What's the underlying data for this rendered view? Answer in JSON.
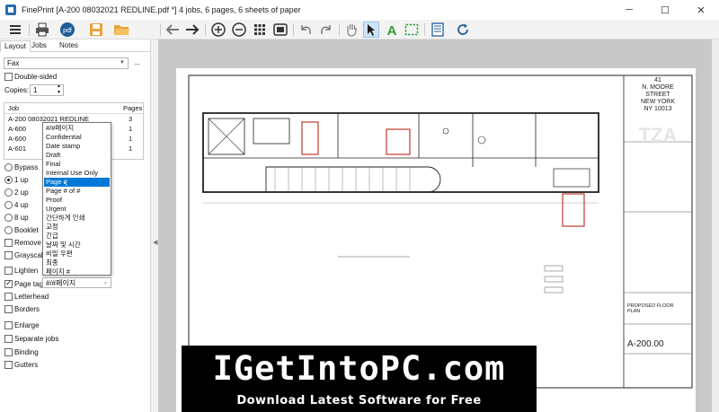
{
  "window": {
    "title": "FinePrint [A-200 08032021 REDLINE.pdf *] 4 jobs, 6 pages, 6 sheets of paper"
  },
  "toolbar": {
    "icons": [
      "menu-icon",
      "printer-icon",
      "pdf-icon",
      "save-icon",
      "open-folder-icon",
      "back-arrow-icon",
      "forward-arrow-icon",
      "zoom-in-icon",
      "zoom-out-icon",
      "grid-icon",
      "fit-page-icon",
      "undo-icon",
      "redo-icon",
      "hand-icon",
      "select-arrow-icon",
      "text-tool-icon",
      "select-area-icon",
      "page-setup-icon",
      "refresh-icon"
    ],
    "pdf_label": "pdf"
  },
  "tabs": [
    "Layout",
    "Jobs",
    "Notes"
  ],
  "printer": {
    "value": "Fax",
    "more": "..."
  },
  "double_sided": {
    "label": "Double-sided",
    "checked": false
  },
  "copies": {
    "label": "Copies:",
    "value": "1"
  },
  "jobs": {
    "headers": [
      "Job",
      "Pages"
    ],
    "rows": [
      {
        "name": "A-200 08032021 REDLINE",
        "pages": "3"
      },
      {
        "name": "A-600",
        "pages": "1"
      },
      {
        "name": "A-600",
        "pages": "1"
      },
      {
        "name": "A-601",
        "pages": "1"
      }
    ]
  },
  "layout_options": [
    {
      "label": "Bypass",
      "checked": false
    },
    {
      "label": "1 up",
      "checked": true
    },
    {
      "label": "2 up",
      "checked": false
    },
    {
      "label": "4 up",
      "checked": false
    },
    {
      "label": "8 up",
      "checked": false
    },
    {
      "label": "Booklet",
      "checked": false
    }
  ],
  "options": {
    "remove": "Remove g",
    "grayscale": "Grayscale",
    "lighten": "Lighten",
    "page_tag": "Page tag",
    "page_tag_value": "#/#페이지",
    "letterhead": "Letterhead",
    "borders": "Borders",
    "enlarge": "Enlarge",
    "separate_jobs": "Separate jobs",
    "binding": "Binding",
    "gutters": "Gutters"
  },
  "dropdown": {
    "items": [
      "#/#페이지",
      "Confidential",
      "Date stamp",
      "Draft",
      "Final",
      "Internal Use Only",
      "Page #",
      "Page # of #",
      "Proof",
      "Urgent",
      "간단하게 인쇄",
      "교정",
      "긴급",
      "날짜 및 시간",
      "비밀 우편",
      "최종",
      "페이지 #"
    ],
    "selected_index": 6
  },
  "drawing": {
    "title_block": [
      "41",
      "N. MOORE",
      "STREET",
      "NEW YORK",
      "NY 10013"
    ],
    "logo": "TZA",
    "plan_label": "PROPOSED FLOOR PLAN",
    "sheet": "A-200.00"
  },
  "banner": {
    "title": "IGetIntoPC.com",
    "subtitle": "Download Latest Software for Free"
  },
  "colors": {
    "accent": "#0078d7",
    "toolbar_bg": "#f3f3f3",
    "doc_bg": "#c8c8c8",
    "redline": "#c0392b"
  }
}
